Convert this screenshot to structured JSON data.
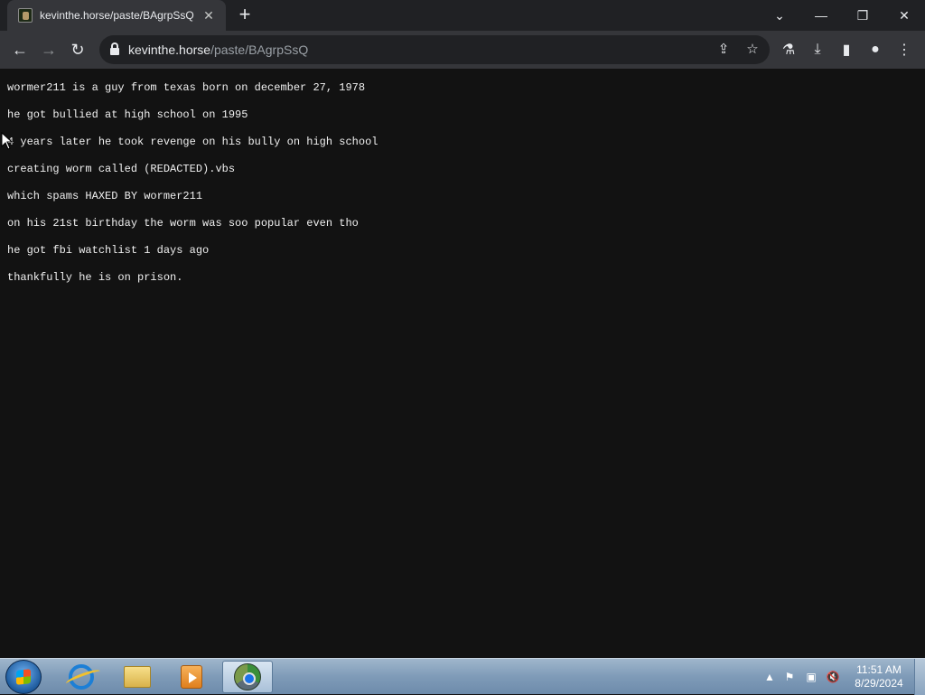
{
  "browser": {
    "tab": {
      "title": "kevinthe.horse/paste/BAgrpSsQ",
      "close": "✕"
    },
    "newtab": "+",
    "window_controls": {
      "tab_search": "⌄",
      "minimize": "—",
      "restore": "❐",
      "close": "✕"
    },
    "nav": {
      "back": "←",
      "forward": "→",
      "reload": "↻"
    },
    "address": {
      "host": "kevinthe.horse",
      "path": "/paste/BAgrpSsQ"
    },
    "omnibox_icons": {
      "share": "⇪",
      "bookmark": "☆"
    },
    "toolbar_icons": {
      "labs": "⚗",
      "download": "⤓",
      "sidepanel": "▮",
      "profile": "●",
      "menu": "⋮"
    }
  },
  "paste": {
    "lines": [
      "wormer211 is a guy from texas born on december 27, 1978",
      "he got bullied at high school on 1995",
      "4 years later he took revenge on his bully on high school",
      "creating worm called (REDACTED).vbs",
      "which spams HAXED BY wormer211",
      "on his 21st birthday the worm was soo popular even tho",
      "he got fbi watchlist 1 days ago",
      "thankfully he is on prison."
    ]
  },
  "taskbar": {
    "tray": {
      "show_hidden": "▲",
      "flag": "⚑",
      "network": "▣",
      "volume": "🔇"
    },
    "clock": {
      "time": "11:51 AM",
      "date": "8/29/2024"
    }
  }
}
